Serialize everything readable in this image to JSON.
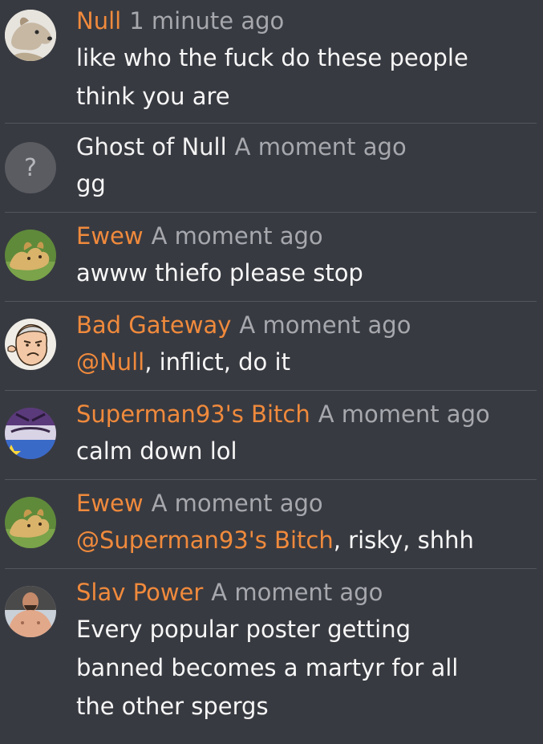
{
  "messages": [
    {
      "avatar_icon": "dog-avatar-icon",
      "username": "Null",
      "time": "1 minute ago",
      "text": "like who the fuck do these people think you are"
    },
    {
      "avatar_icon": "unknown-user-avatar-icon",
      "avatar_glyph": "?",
      "username": "Ghost of Null",
      "time": "A moment ago",
      "text": "gg"
    },
    {
      "avatar_icon": "creature-avatar-icon",
      "username": "Ewew",
      "time": "A moment ago",
      "text": "awww thiefo please stop"
    },
    {
      "avatar_icon": "cartoon-face-avatar-icon",
      "username": "Bad Gateway",
      "time": "A moment ago",
      "mention": "@Null",
      "text": ", inflict, do it"
    },
    {
      "avatar_icon": "cartoon-creature-avatar-icon",
      "username": "Superman93's Bitch",
      "time": "A moment ago",
      "text": "calm down lol"
    },
    {
      "avatar_icon": "creature-avatar-icon",
      "username": "Ewew",
      "time": "A moment ago",
      "mention": "@Superman93's Bitch",
      "text": ", risky, shhh"
    },
    {
      "avatar_icon": "person-avatar-icon",
      "username": "Slav Power",
      "time": "A moment ago",
      "text": "Every popular poster getting banned becomes a martyr for all the other spergs"
    }
  ],
  "colors": {
    "background": "#383a41",
    "username": "#f08a3c",
    "timestamp": "#a6a8ae",
    "divider": "#53565e"
  }
}
